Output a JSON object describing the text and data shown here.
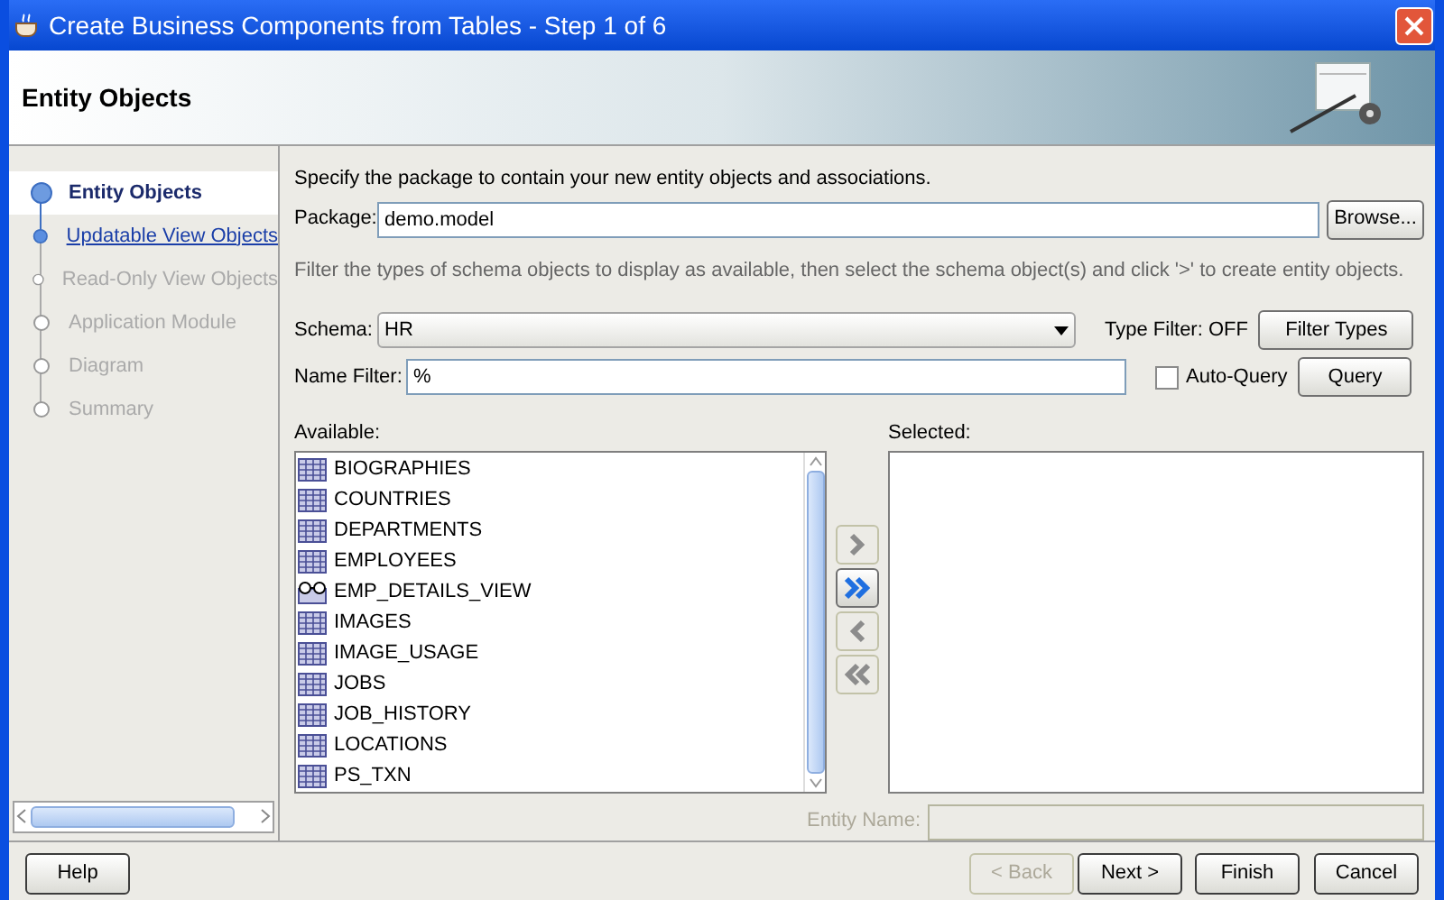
{
  "window": {
    "title": "Create Business Components from Tables - Step 1 of 6"
  },
  "header": {
    "title": "Entity Objects"
  },
  "steps": [
    {
      "label": "Entity Objects",
      "selected": true,
      "disabled": false
    },
    {
      "label": "Updatable View Objects",
      "selected": false,
      "disabled": false
    },
    {
      "label": "Read-Only View Objects",
      "selected": false,
      "disabled": true
    },
    {
      "label": "Application Module",
      "selected": false,
      "disabled": true
    },
    {
      "label": "Diagram",
      "selected": false,
      "disabled": true
    },
    {
      "label": "Summary",
      "selected": false,
      "disabled": true
    }
  ],
  "instruction": "Specify the package to contain your new entity objects and associations.",
  "package": {
    "label": "Package:",
    "value": "demo.model",
    "button": "Browse..."
  },
  "filter_hint": "Filter the types of schema objects to display as available, then select the schema object(s) and click '>' to create entity objects.",
  "schema": {
    "label": "Schema:",
    "value": "HR"
  },
  "type_filter": {
    "label": "Type Filter: OFF",
    "button": "Filter Types"
  },
  "name_filter": {
    "label": "Name Filter:",
    "value": "%"
  },
  "auto_query": {
    "label": "Auto-Query",
    "checked": false
  },
  "query_button": "Query",
  "available": {
    "label": "Available:",
    "items": [
      {
        "name": "BIOGRAPHIES",
        "kind": "table"
      },
      {
        "name": "COUNTRIES",
        "kind": "table"
      },
      {
        "name": "DEPARTMENTS",
        "kind": "table"
      },
      {
        "name": "EMPLOYEES",
        "kind": "table"
      },
      {
        "name": "EMP_DETAILS_VIEW",
        "kind": "view"
      },
      {
        "name": "IMAGES",
        "kind": "table"
      },
      {
        "name": "IMAGE_USAGE",
        "kind": "table"
      },
      {
        "name": "JOBS",
        "kind": "table"
      },
      {
        "name": "JOB_HISTORY",
        "kind": "table"
      },
      {
        "name": "LOCATIONS",
        "kind": "table"
      },
      {
        "name": "PS_TXN",
        "kind": "table"
      }
    ]
  },
  "shuttle": [
    {
      "kind": "add",
      "disabled": true
    },
    {
      "kind": "add_all",
      "disabled": false
    },
    {
      "kind": "remove",
      "disabled": true
    },
    {
      "kind": "remove_all",
      "disabled": true
    }
  ],
  "selected": {
    "label": "Selected:"
  },
  "entity_name": {
    "label": "Entity Name:",
    "disabled": true
  },
  "footer": {
    "help": {
      "label": "Help",
      "disabled": false
    },
    "buttons": [
      {
        "label": "< Back",
        "disabled": true
      },
      {
        "label": "Next >",
        "disabled": false
      },
      {
        "label": "Finish",
        "disabled": false
      },
      {
        "label": "Cancel",
        "disabled": false
      }
    ]
  }
}
